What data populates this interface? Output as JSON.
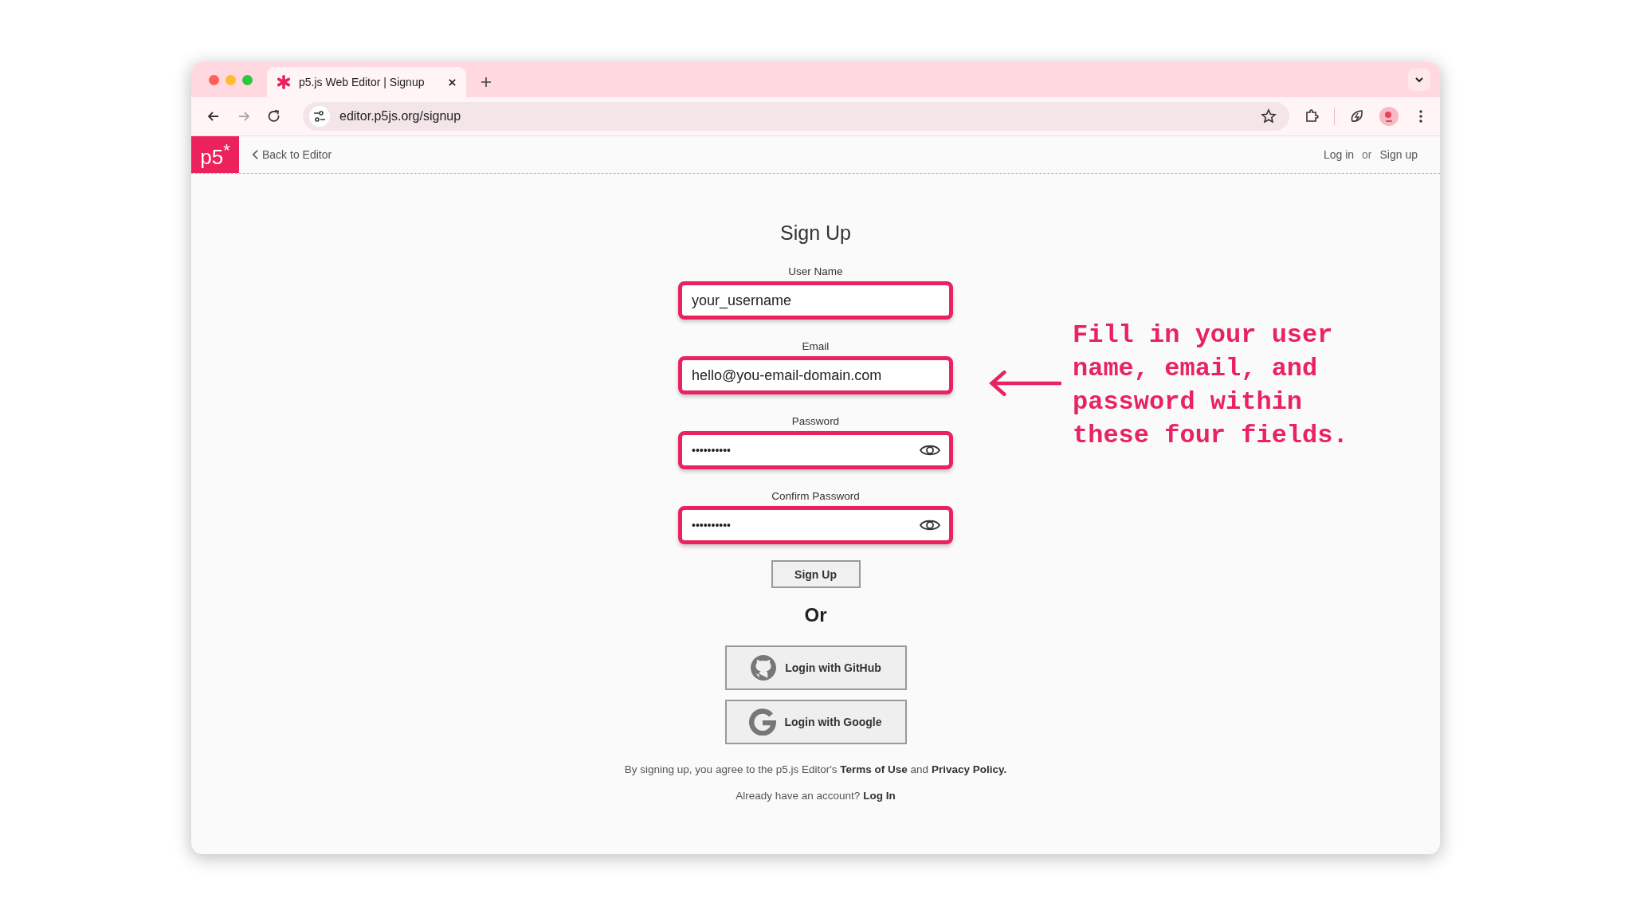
{
  "browser": {
    "tabs": [
      {
        "title": "p5.js Web Editor | Signup",
        "selected": true
      }
    ],
    "url": "editor.p5js.org/signup"
  },
  "header": {
    "logo": "p5$^{*}$",
    "back_link": "Back to Editor",
    "login_link": "Log in",
    "separator": "or",
    "signup_link": "Sign up"
  },
  "form": {
    "title": "Sign Up",
    "fields": [
      {
        "label": "User Name",
        "value": "your_username",
        "kind": "text",
        "highlighted": true
      },
      {
        "label": "Email",
        "value": "hello@you-email-domain.com",
        "kind": "text",
        "highlighted": true
      },
      {
        "label": "Password",
        "value": "••••••••••",
        "kind": "password",
        "highlighted": true
      },
      {
        "label": "Confirm Password",
        "value": "••••••••••",
        "kind": "password",
        "highlighted": true
      }
    ],
    "submit": "Sign Up",
    "divider": "Or",
    "oauth": [
      {
        "label": "Login with GitHub",
        "kind": "github"
      },
      {
        "label": "Login with Google",
        "kind": "google"
      }
    ],
    "terms": "By signing up, you agree to the p5.js Editor's **Terms of Use** and **Privacy Policy.**",
    "account_prompt": "Already have an account?",
    "account_link": "Log In"
  },
  "annotation": {
    "text": "Fill in your user name, email, and password within these four fields."
  }
}
